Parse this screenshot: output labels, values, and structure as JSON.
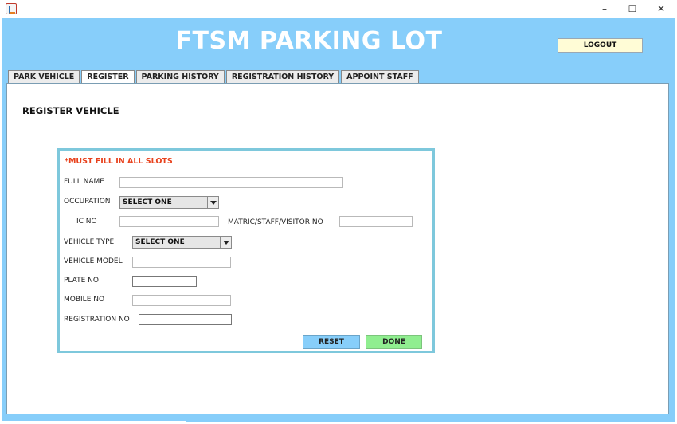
{
  "window": {
    "minimize": "–",
    "maximize": "☐",
    "close": "✕"
  },
  "header": {
    "title": "FTSM PARKING LOT",
    "logout_label": "LOGOUT"
  },
  "tabs": [
    {
      "label": "PARK VEHICLE",
      "active": false
    },
    {
      "label": "REGISTER",
      "active": true
    },
    {
      "label": "PARKING HISTORY",
      "active": false
    },
    {
      "label": "REGISTRATION HISTORY",
      "active": false
    },
    {
      "label": "APPOINT STAFF",
      "active": false
    }
  ],
  "form": {
    "section_title": "REGISTER VEHICLE",
    "warning": "*MUST FILL IN ALL SLOTS",
    "full_name_label": "FULL NAME",
    "full_name_value": "",
    "occupation_label": "OCCUPATION",
    "occupation_value": "SELECT ONE",
    "ic_no_label": "IC NO",
    "ic_no_value": "",
    "matric_label": "MATRIC/STAFF/VISITOR NO",
    "matric_value": "",
    "vehicle_type_label": "VEHICLE TYPE",
    "vehicle_type_value": "SELECT ONE",
    "vehicle_model_label": "VEHICLE MODEL",
    "vehicle_model_value": "",
    "plate_no_label": "PLATE NO",
    "plate_no_value": "",
    "mobile_no_label": "MOBILE NO",
    "mobile_no_value": "",
    "registration_no_label": "REGISTRATION NO",
    "registration_no_value": "",
    "reset_label": "RESET",
    "done_label": "DONE"
  },
  "colors": {
    "frame_bg": "#87cefa",
    "warning": "#e8421d",
    "reset_bg": "#87cefa",
    "done_bg": "#90ee90",
    "logout_bg": "#fffcd6"
  }
}
